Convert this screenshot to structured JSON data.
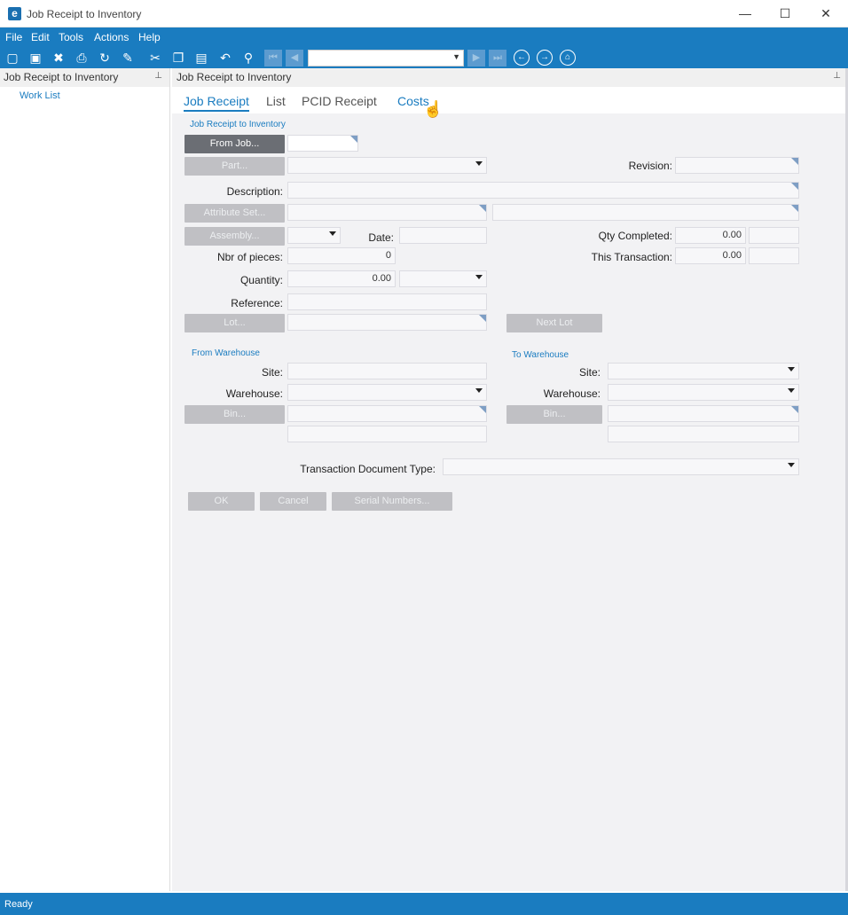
{
  "window": {
    "title": "Job Receipt to Inventory",
    "logo": "e",
    "minimize": "—",
    "maximize": "☐",
    "close": "✕"
  },
  "menu": [
    "File",
    "Edit",
    "Tools",
    "Actions",
    "Help"
  ],
  "toolbar": {
    "icons": [
      "new-icon",
      "save-icon",
      "delete-icon",
      "print-icon",
      "refresh-icon",
      "clear-icon",
      "cut-icon",
      "copy-icon",
      "paste-icon",
      "undo-icon",
      "search-icon"
    ]
  },
  "leftpane": {
    "header": "Job Receipt to Inventory",
    "worklist": "Work List"
  },
  "main": {
    "header": "Job Receipt to Inventory",
    "tabs": [
      "Job Receipt",
      "List",
      "PCID Receipt",
      "Costs"
    ],
    "group_job": "Job Receipt to Inventory",
    "from_job_btn": "From Job...",
    "part_btn": "Part...",
    "revision_label": "Revision:",
    "description_label": "Description:",
    "attribute_btn": "Attribute Set...",
    "assembly_btn": "Assembly...",
    "date_label": "Date:",
    "qty_completed_label": "Qty Completed:",
    "qty_completed_value": "0.00",
    "nbr_pieces_label": "Nbr of pieces:",
    "nbr_pieces_value": "0",
    "this_transaction_label": "This Transaction:",
    "this_transaction_value": "0.00",
    "quantity_label": "Quantity:",
    "quantity_value": "0.00",
    "reference_label": "Reference:",
    "lot_btn": "Lot...",
    "next_lot_btn": "Next Lot",
    "from_warehouse_group": "From Warehouse",
    "to_warehouse_group": "To Warehouse",
    "site_label": "Site:",
    "warehouse_label": "Warehouse:",
    "bin_btn": "Bin...",
    "tran_doc_type_label": "Transaction Document Type:",
    "ok_btn": "OK",
    "cancel_btn": "Cancel",
    "serial_btn": "Serial Numbers..."
  },
  "status": "Ready"
}
